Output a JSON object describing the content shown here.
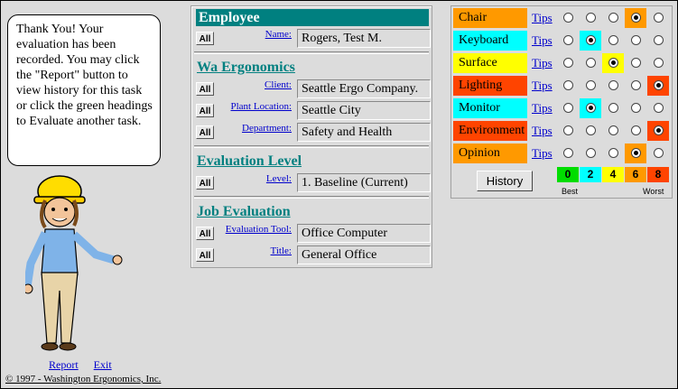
{
  "message": "Thank You! Your evaluation has been recorded. You may click the \"Report\" button to view history for this task or click the green headings to Evaluate another task.",
  "links": {
    "report": "Report",
    "exit": "Exit"
  },
  "copyright": "© 1997 - Washington Ergonomics, Inc.",
  "all_label": "All",
  "employee": {
    "heading": "Employee",
    "name_label": "Name:",
    "name_value": "Rogers, Test M."
  },
  "wa_ergonomics": {
    "heading": "Wa Ergonomics",
    "client_label": "Client:",
    "client_value": "Seattle Ergo Company.",
    "plant_label": "Plant Location:",
    "plant_value": "Seattle City",
    "department_label": "Department:",
    "department_value": "Safety and Health"
  },
  "evaluation_level": {
    "heading": "Evaluation Level",
    "level_label": "Level:",
    "level_value": "1. Baseline (Current)"
  },
  "job_evaluation": {
    "heading": "Job Evaluation",
    "tool_label": "Evaluation Tool:",
    "tool_value": "Office Computer",
    "title_label": "Title:",
    "title_value": "General Office"
  },
  "ratings": {
    "tips_label": "Tips",
    "history_label": "History",
    "best_label": "Best",
    "worst_label": "Worst",
    "scores": [
      "0",
      "2",
      "4",
      "6",
      "8"
    ],
    "score_colors": [
      "#00dd00",
      "#00ffff",
      "#ffff00",
      "#ff9900",
      "#ff4400"
    ],
    "categories": [
      {
        "name": "Chair",
        "color": "#ff9900",
        "selected": 3
      },
      {
        "name": "Keyboard",
        "color": "#00ffff",
        "selected": 1
      },
      {
        "name": "Surface",
        "color": "#ffff00",
        "selected": 2
      },
      {
        "name": "Lighting",
        "color": "#ff4400",
        "selected": 4
      },
      {
        "name": "Monitor",
        "color": "#00ffff",
        "selected": 1
      },
      {
        "name": "Environment",
        "color": "#ff4400",
        "selected": 4
      },
      {
        "name": "Opinion",
        "color": "#ff9900",
        "selected": 3
      }
    ]
  }
}
